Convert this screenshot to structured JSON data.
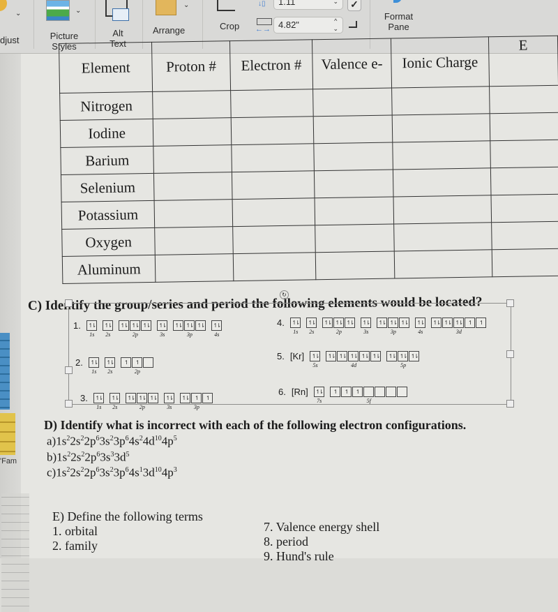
{
  "ribbon": {
    "adjust_label": "djust",
    "picture_styles_label": "Picture Styles",
    "alt_text_label": "Alt Text",
    "arrange_label": "Arrange",
    "crop_label": "Crop",
    "height_value": "1.11",
    "width_value": "4.82\"",
    "format_pane_label": "Format Pane"
  },
  "table": {
    "headers": [
      "Element",
      "Proton #",
      "Electron #",
      "Valence e-",
      "Ionic Charge",
      "E"
    ],
    "rows": [
      "Nitrogen",
      "Iodine",
      "Barium",
      "Selenium",
      "Potassium",
      "Oxygen",
      "Aluminum"
    ]
  },
  "section_c": {
    "title": "C) Identify the group/series and period the following elements would be located?",
    "rotate_icon": "rotate-handle-icon",
    "configs": [
      {
        "num": "1.",
        "core": "",
        "subshells": [
          {
            "label": "1s",
            "orbitals": [
              "↿⇂"
            ]
          },
          {
            "label": "2s",
            "orbitals": [
              "↿⇂"
            ]
          },
          {
            "label": "2p",
            "orbitals": [
              "↿⇂",
              "↿⇂",
              "↿⇂"
            ]
          },
          {
            "label": "3s",
            "orbitals": [
              "↿⇂"
            ]
          },
          {
            "label": "3p",
            "orbitals": [
              "↿⇂",
              "↿⇂",
              "↿⇂"
            ]
          },
          {
            "label": "4s",
            "orbitals": [
              "↿⇂"
            ]
          }
        ]
      },
      {
        "num": "2.",
        "core": "",
        "subshells": [
          {
            "label": "1s",
            "orbitals": [
              "↿⇂"
            ]
          },
          {
            "label": "2s",
            "orbitals": [
              "↿⇂"
            ]
          },
          {
            "label": "2p",
            "orbitals": [
              "↿",
              "↿",
              ""
            ]
          }
        ]
      },
      {
        "num": "3.",
        "core": "",
        "subshells": [
          {
            "label": "1s",
            "orbitals": [
              "↿⇂"
            ]
          },
          {
            "label": "2s",
            "orbitals": [
              "↿⇂"
            ]
          },
          {
            "label": "2p",
            "orbitals": [
              "↿⇂",
              "↿⇂",
              "↿⇂"
            ]
          },
          {
            "label": "3s",
            "orbitals": [
              "↿⇂"
            ]
          },
          {
            "label": "3p",
            "orbitals": [
              "↿⇂",
              "↿",
              "↿"
            ]
          }
        ]
      },
      {
        "num": "4.",
        "core": "",
        "subshells": [
          {
            "label": "1s",
            "orbitals": [
              "↿⇂"
            ]
          },
          {
            "label": "2s",
            "orbitals": [
              "↿⇂"
            ]
          },
          {
            "label": "2p",
            "orbitals": [
              "↿⇂",
              "↿⇂",
              "↿⇂"
            ]
          },
          {
            "label": "3s",
            "orbitals": [
              "↿⇂"
            ]
          },
          {
            "label": "3p",
            "orbitals": [
              "↿⇂",
              "↿⇂",
              "↿⇂"
            ]
          },
          {
            "label": "4s",
            "orbitals": [
              "↿⇂"
            ]
          },
          {
            "label": "3d",
            "orbitals": [
              "↿⇂",
              "↿⇂",
              "↿⇂",
              "↿",
              "↿"
            ]
          }
        ]
      },
      {
        "num": "5.",
        "core": "[Kr]",
        "subshells": [
          {
            "label": "5s",
            "orbitals": [
              "↿⇂"
            ]
          },
          {
            "label": "4d",
            "orbitals": [
              "↿⇂",
              "↿⇂",
              "↿⇂",
              "↿⇂",
              "↿⇂"
            ]
          },
          {
            "label": "5p",
            "orbitals": [
              "↿⇂",
              "↿⇂",
              "↿⇂"
            ]
          }
        ]
      },
      {
        "num": "6.",
        "core": "[Rn]",
        "subshells": [
          {
            "label": "7s",
            "orbitals": [
              "↿⇂"
            ]
          },
          {
            "label": "5f",
            "orbitals": [
              "↿",
              "↿",
              "↿",
              "",
              "",
              "",
              ""
            ]
          }
        ]
      }
    ]
  },
  "section_d": {
    "title": "D) Identify what is incorrect with each of the following electron configurations.",
    "items": [
      {
        "prefix": "a)",
        "parts": [
          [
            "1s",
            "2"
          ],
          [
            "2s",
            "2"
          ],
          [
            "2p",
            "6"
          ],
          [
            "3s",
            "2"
          ],
          [
            "3p",
            "6"
          ],
          [
            "4s",
            "2"
          ],
          [
            "4d",
            "10"
          ],
          [
            "4p",
            "5"
          ]
        ]
      },
      {
        "prefix": "b)",
        "parts": [
          [
            "1s",
            "2"
          ],
          [
            "2s",
            "2"
          ],
          [
            "2p",
            "6"
          ],
          [
            "3s",
            "3"
          ],
          [
            "3d",
            "5"
          ]
        ]
      },
      {
        "prefix": "c)",
        "parts": [
          [
            "1s",
            "2"
          ],
          [
            "2s",
            "2"
          ],
          [
            "2p",
            "6"
          ],
          [
            "3s",
            "2"
          ],
          [
            "3p",
            "6"
          ],
          [
            "4s",
            "1"
          ],
          [
            "3d",
            "10"
          ],
          [
            "4p",
            "3"
          ]
        ]
      }
    ]
  },
  "section_e": {
    "title": "E) Define the following terms",
    "left_terms": [
      "1. orbital",
      "2. family"
    ],
    "right_terms": [
      "7. Valence energy shell",
      "8. period",
      "9. Hund's rule"
    ]
  },
  "sidebar": {
    "fam_label": "'Fam"
  }
}
